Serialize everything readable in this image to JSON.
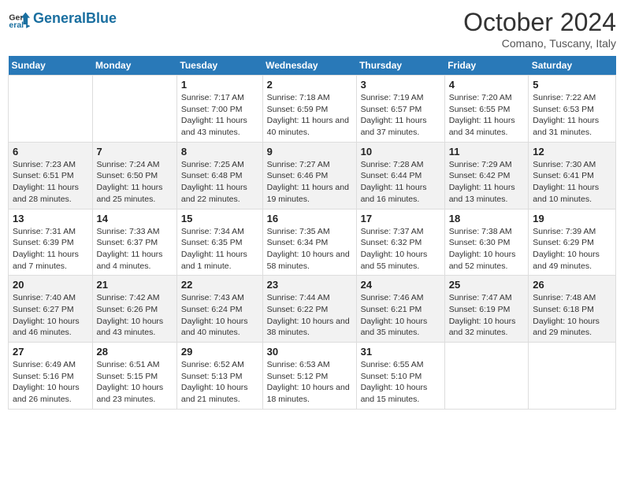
{
  "logo": {
    "text_general": "General",
    "text_blue": "Blue"
  },
  "title": "October 2024",
  "location": "Comano, Tuscany, Italy",
  "days_of_week": [
    "Sunday",
    "Monday",
    "Tuesday",
    "Wednesday",
    "Thursday",
    "Friday",
    "Saturday"
  ],
  "weeks": [
    [
      {
        "day": "",
        "info": ""
      },
      {
        "day": "",
        "info": ""
      },
      {
        "day": "1",
        "info": "Sunrise: 7:17 AM\nSunset: 7:00 PM\nDaylight: 11 hours and 43 minutes."
      },
      {
        "day": "2",
        "info": "Sunrise: 7:18 AM\nSunset: 6:59 PM\nDaylight: 11 hours and 40 minutes."
      },
      {
        "day": "3",
        "info": "Sunrise: 7:19 AM\nSunset: 6:57 PM\nDaylight: 11 hours and 37 minutes."
      },
      {
        "day": "4",
        "info": "Sunrise: 7:20 AM\nSunset: 6:55 PM\nDaylight: 11 hours and 34 minutes."
      },
      {
        "day": "5",
        "info": "Sunrise: 7:22 AM\nSunset: 6:53 PM\nDaylight: 11 hours and 31 minutes."
      }
    ],
    [
      {
        "day": "6",
        "info": "Sunrise: 7:23 AM\nSunset: 6:51 PM\nDaylight: 11 hours and 28 minutes."
      },
      {
        "day": "7",
        "info": "Sunrise: 7:24 AM\nSunset: 6:50 PM\nDaylight: 11 hours and 25 minutes."
      },
      {
        "day": "8",
        "info": "Sunrise: 7:25 AM\nSunset: 6:48 PM\nDaylight: 11 hours and 22 minutes."
      },
      {
        "day": "9",
        "info": "Sunrise: 7:27 AM\nSunset: 6:46 PM\nDaylight: 11 hours and 19 minutes."
      },
      {
        "day": "10",
        "info": "Sunrise: 7:28 AM\nSunset: 6:44 PM\nDaylight: 11 hours and 16 minutes."
      },
      {
        "day": "11",
        "info": "Sunrise: 7:29 AM\nSunset: 6:42 PM\nDaylight: 11 hours and 13 minutes."
      },
      {
        "day": "12",
        "info": "Sunrise: 7:30 AM\nSunset: 6:41 PM\nDaylight: 11 hours and 10 minutes."
      }
    ],
    [
      {
        "day": "13",
        "info": "Sunrise: 7:31 AM\nSunset: 6:39 PM\nDaylight: 11 hours and 7 minutes."
      },
      {
        "day": "14",
        "info": "Sunrise: 7:33 AM\nSunset: 6:37 PM\nDaylight: 11 hours and 4 minutes."
      },
      {
        "day": "15",
        "info": "Sunrise: 7:34 AM\nSunset: 6:35 PM\nDaylight: 11 hours and 1 minute."
      },
      {
        "day": "16",
        "info": "Sunrise: 7:35 AM\nSunset: 6:34 PM\nDaylight: 10 hours and 58 minutes."
      },
      {
        "day": "17",
        "info": "Sunrise: 7:37 AM\nSunset: 6:32 PM\nDaylight: 10 hours and 55 minutes."
      },
      {
        "day": "18",
        "info": "Sunrise: 7:38 AM\nSunset: 6:30 PM\nDaylight: 10 hours and 52 minutes."
      },
      {
        "day": "19",
        "info": "Sunrise: 7:39 AM\nSunset: 6:29 PM\nDaylight: 10 hours and 49 minutes."
      }
    ],
    [
      {
        "day": "20",
        "info": "Sunrise: 7:40 AM\nSunset: 6:27 PM\nDaylight: 10 hours and 46 minutes."
      },
      {
        "day": "21",
        "info": "Sunrise: 7:42 AM\nSunset: 6:26 PM\nDaylight: 10 hours and 43 minutes."
      },
      {
        "day": "22",
        "info": "Sunrise: 7:43 AM\nSunset: 6:24 PM\nDaylight: 10 hours and 40 minutes."
      },
      {
        "day": "23",
        "info": "Sunrise: 7:44 AM\nSunset: 6:22 PM\nDaylight: 10 hours and 38 minutes."
      },
      {
        "day": "24",
        "info": "Sunrise: 7:46 AM\nSunset: 6:21 PM\nDaylight: 10 hours and 35 minutes."
      },
      {
        "day": "25",
        "info": "Sunrise: 7:47 AM\nSunset: 6:19 PM\nDaylight: 10 hours and 32 minutes."
      },
      {
        "day": "26",
        "info": "Sunrise: 7:48 AM\nSunset: 6:18 PM\nDaylight: 10 hours and 29 minutes."
      }
    ],
    [
      {
        "day": "27",
        "info": "Sunrise: 6:49 AM\nSunset: 5:16 PM\nDaylight: 10 hours and 26 minutes."
      },
      {
        "day": "28",
        "info": "Sunrise: 6:51 AM\nSunset: 5:15 PM\nDaylight: 10 hours and 23 minutes."
      },
      {
        "day": "29",
        "info": "Sunrise: 6:52 AM\nSunset: 5:13 PM\nDaylight: 10 hours and 21 minutes."
      },
      {
        "day": "30",
        "info": "Sunrise: 6:53 AM\nSunset: 5:12 PM\nDaylight: 10 hours and 18 minutes."
      },
      {
        "day": "31",
        "info": "Sunrise: 6:55 AM\nSunset: 5:10 PM\nDaylight: 10 hours and 15 minutes."
      },
      {
        "day": "",
        "info": ""
      },
      {
        "day": "",
        "info": ""
      }
    ]
  ]
}
